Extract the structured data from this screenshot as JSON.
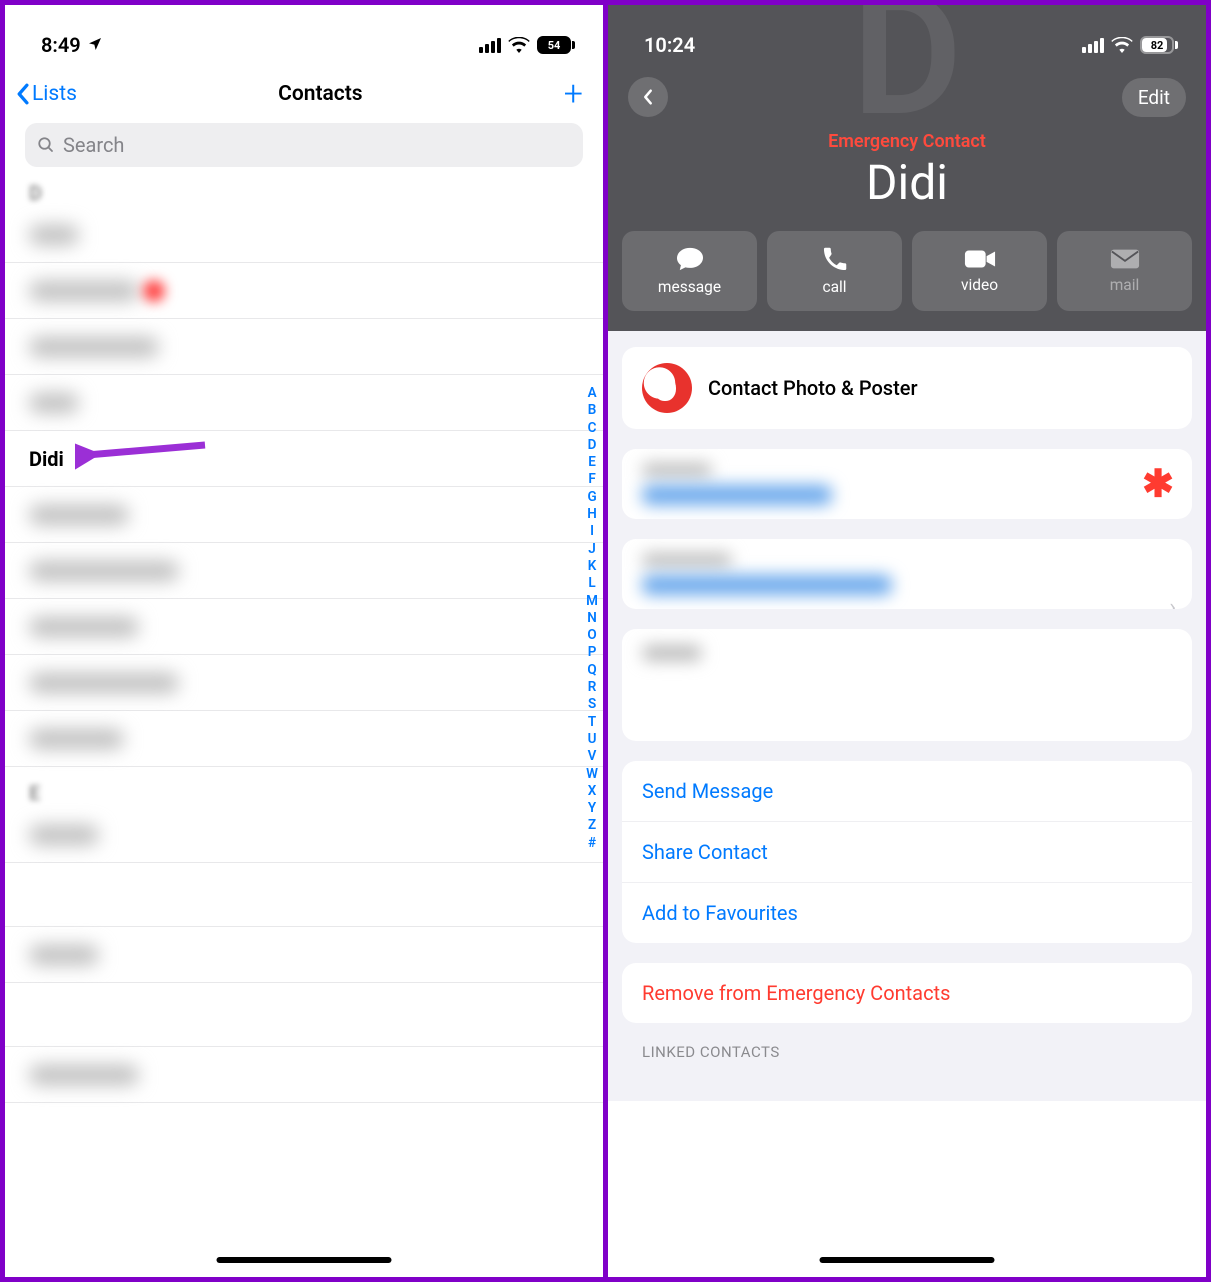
{
  "left": {
    "status_time": "8:49",
    "battery": "54",
    "nav_back": "Lists",
    "nav_title": "Contacts",
    "search_placeholder": "Search",
    "section_d": "D",
    "section_e": "E",
    "didi": "Didi",
    "index": [
      "A",
      "B",
      "C",
      "D",
      "E",
      "F",
      "G",
      "H",
      "I",
      "J",
      "K",
      "L",
      "M",
      "N",
      "O",
      "P",
      "Q",
      "R",
      "S",
      "T",
      "U",
      "V",
      "W",
      "X",
      "Y",
      "Z",
      "#"
    ]
  },
  "right": {
    "status_time": "10:24",
    "battery": "82",
    "edit": "Edit",
    "emergency": "Emergency Contact",
    "name": "Didi",
    "actions": {
      "message": "message",
      "call": "call",
      "video": "video",
      "mail": "mail"
    },
    "photo_poster": "Contact Photo & Poster",
    "send_message": "Send Message",
    "share_contact": "Share Contact",
    "add_fav": "Add to Favourites",
    "remove_emg": "Remove from Emergency Contacts",
    "linked": "LINKED CONTACTS"
  }
}
